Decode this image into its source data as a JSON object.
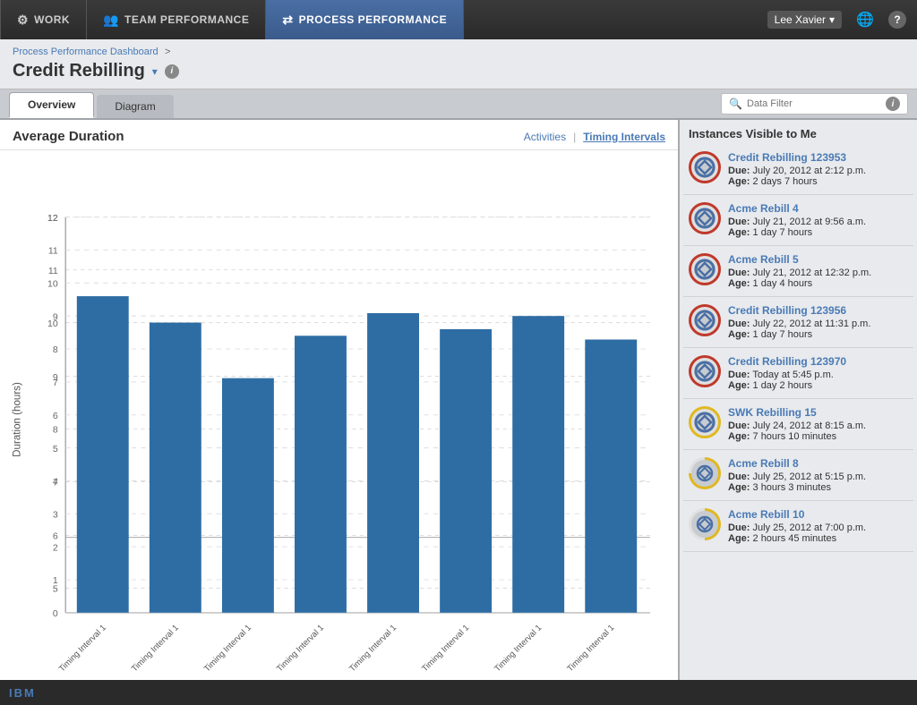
{
  "nav": {
    "tabs": [
      {
        "id": "work",
        "label": "WORK",
        "icon": "⚙",
        "active": false
      },
      {
        "id": "team",
        "label": "TEAM PERFORMANCE",
        "icon": "👥",
        "active": false
      },
      {
        "id": "process",
        "label": "PROCESS PERFORMANCE",
        "icon": "⇄",
        "active": true
      }
    ],
    "user": "Lee Xavier",
    "globe_icon": "🌐",
    "help_icon": "?"
  },
  "breadcrumb": {
    "parent": "Process Performance Dashboard",
    "separator": ">",
    "current": "Credit Rebilling"
  },
  "page_title": "Credit Rebilling",
  "sub_tabs": [
    {
      "label": "Overview",
      "active": true
    },
    {
      "label": "Diagram",
      "active": false
    }
  ],
  "chart": {
    "title": "Average Duration",
    "links": [
      {
        "label": "Activities",
        "active": false
      },
      {
        "separator": "|"
      },
      {
        "label": "Timing Intervals",
        "active": true
      }
    ],
    "y_axis_label": "Duration (hours)",
    "y_axis_max": 12,
    "bars": [
      {
        "label": "Timing Interval 1",
        "value": 9.6
      },
      {
        "label": "Timing Interval 1",
        "value": 8.8
      },
      {
        "label": "Timing Interval 1",
        "value": 7.1
      },
      {
        "label": "Timing Interval 1",
        "value": 8.4
      },
      {
        "label": "Timing Interval 1",
        "value": 9.1
      },
      {
        "label": "Timing Interval 1",
        "value": 8.6
      },
      {
        "label": "Timing Interval 1",
        "value": 9.0
      },
      {
        "label": "Timing Interval 1",
        "value": 8.3
      }
    ]
  },
  "right_panel": {
    "search_placeholder": "Data Filter",
    "instances_title": "Instances Visible to Me",
    "instances": [
      {
        "name": "Credit Rebilling 123953",
        "due_label": "Due:",
        "due": "July 20, 2012 at 2:12 p.m.",
        "age_label": "Age:",
        "age": "2 days 7 hours",
        "status": "red"
      },
      {
        "name": "Acme Rebill 4",
        "due_label": "Due:",
        "due": "July 21, 2012 at 9:56 a.m.",
        "age_label": "Age:",
        "age": "1 day 7 hours",
        "status": "red"
      },
      {
        "name": "Acme Rebill 5",
        "due_label": "Due:",
        "due": "July 21, 2012 at 12:32 p.m.",
        "age_label": "Age:",
        "age": "1 day 4 hours",
        "status": "red"
      },
      {
        "name": "Credit Rebilling 123956",
        "due_label": "Due:",
        "due": "July 22, 2012 at 11:31 p.m.",
        "age_label": "Age:",
        "age": "1 day 7 hours",
        "status": "red"
      },
      {
        "name": "Credit Rebilling 123970",
        "due_label": "Due:",
        "due": "Today at 5:45 p.m.",
        "age_label": "Age:",
        "age": "1 day 2 hours",
        "status": "red"
      },
      {
        "name": "SWK Rebilling 15",
        "due_label": "Due:",
        "due": "July 24, 2012 at 8:15 a.m.",
        "age_label": "Age:",
        "age": "7 hours 10 minutes",
        "status": "yellow"
      },
      {
        "name": "Acme Rebill 8",
        "due_label": "Due:",
        "due": "July 25, 2012 at 5:15 p.m.",
        "age_label": "Age:",
        "age": "3 hours 3 minutes",
        "status": "partial"
      },
      {
        "name": "Acme Rebill 10",
        "due_label": "Due:",
        "due": "July 25, 2012 at 7:00 p.m.",
        "age_label": "Age:",
        "age": "2 hours 45 minutes",
        "status": "partial"
      }
    ]
  },
  "bottom": {
    "ibm_label": "IBM"
  }
}
